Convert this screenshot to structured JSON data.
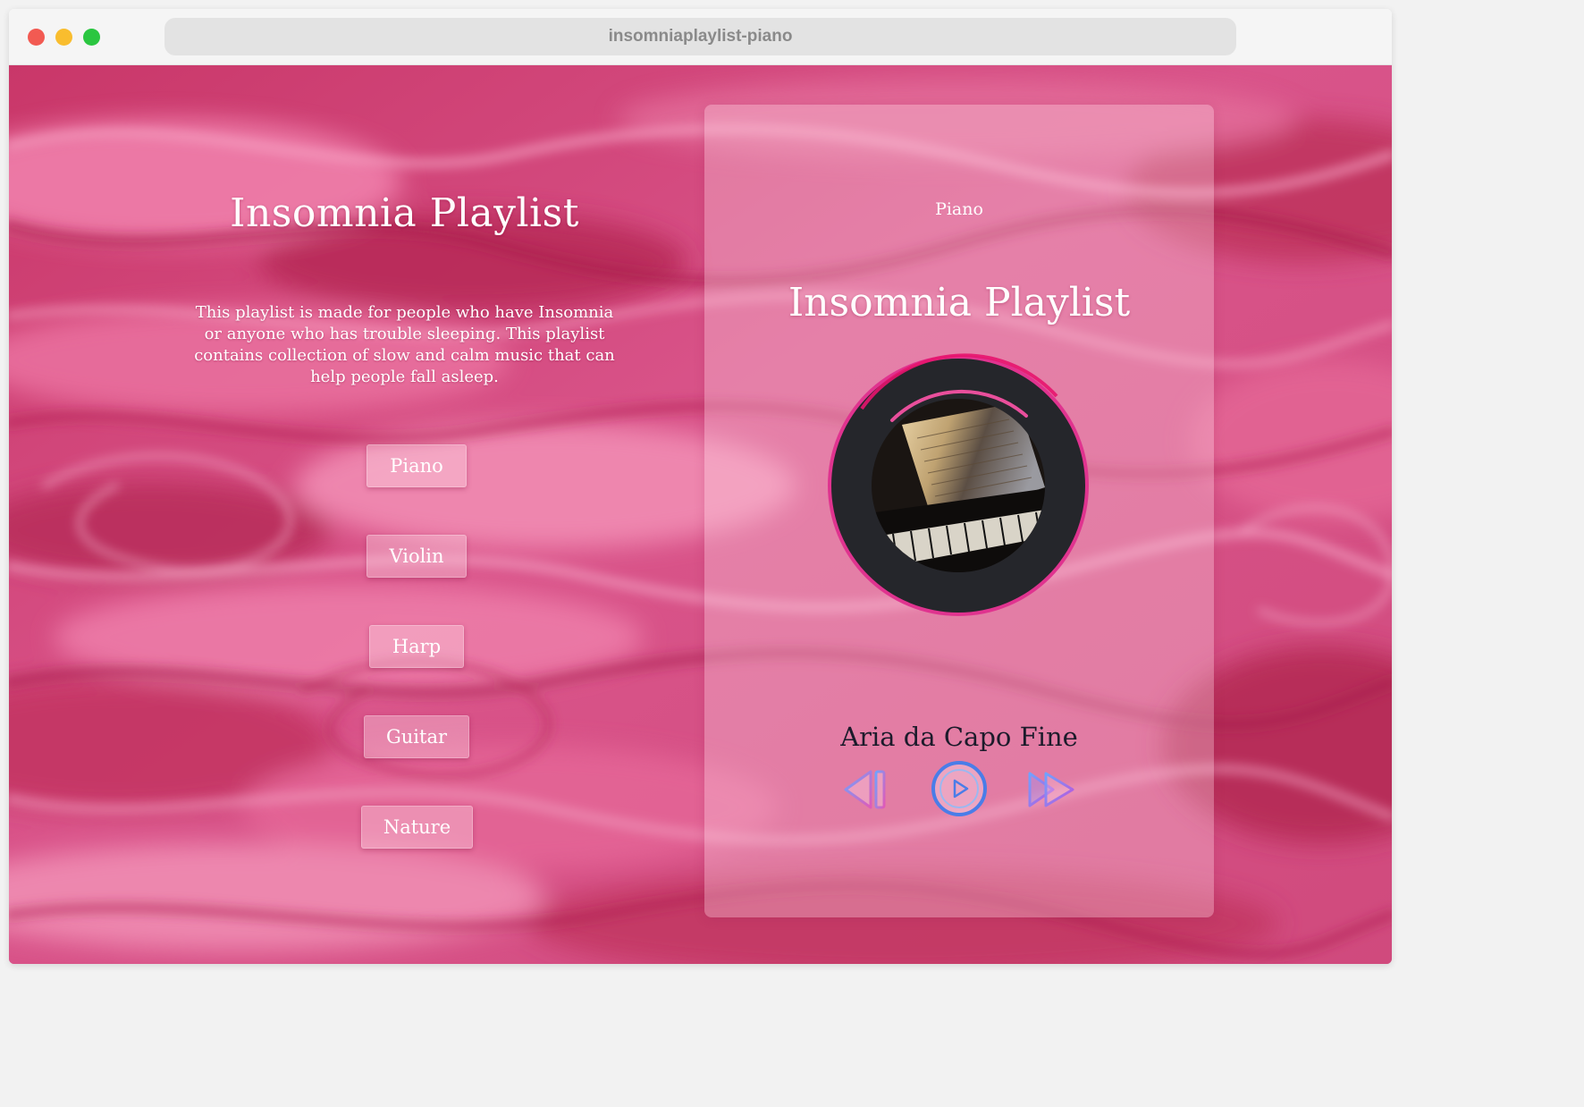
{
  "browser": {
    "url": "insomniaplaylist-piano"
  },
  "page": {
    "title": "Insomnia Playlist",
    "description": "This playlist is made for people who have Insomnia or anyone who has trouble sleeping. This playlist contains collection of slow and calm music that can help people fall asleep.",
    "categories": [
      "Piano",
      "Violin",
      "Harp",
      "Guitar",
      "Nature"
    ]
  },
  "player": {
    "category": "Piano",
    "title": "Insomnia Playlist",
    "track": "Aria da Capo Fine",
    "controls": [
      "previous",
      "play",
      "next"
    ]
  },
  "colors": {
    "background": "#d24c7d",
    "accent": "#e0338f",
    "disc": "#25262b",
    "play_ring": "#4a7de8",
    "prev_icon": "#b55ae0",
    "next_icon": "#a764e6",
    "track_text": "#1c1b2b"
  },
  "icons": [
    "previous-icon",
    "play-icon",
    "next-icon"
  ]
}
